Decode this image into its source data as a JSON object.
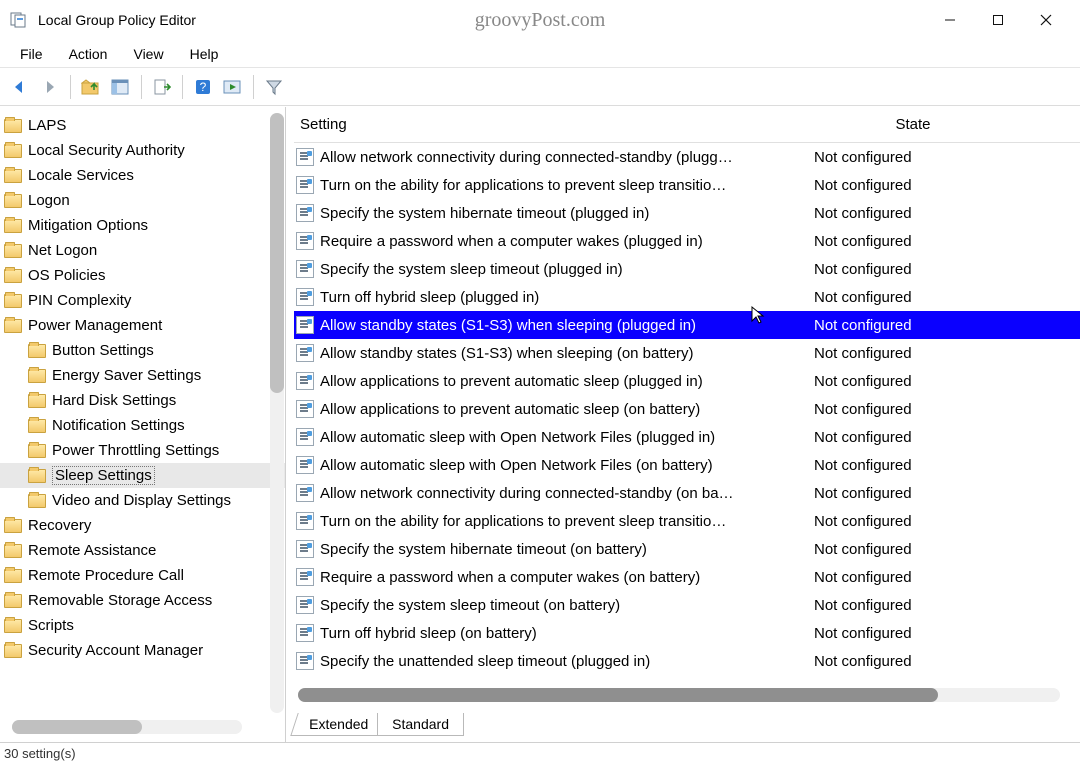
{
  "window": {
    "title": "Local Group Policy Editor",
    "watermark": "groovyPost.com"
  },
  "menu": [
    "File",
    "Action",
    "View",
    "Help"
  ],
  "toolbar_icons": [
    "back",
    "forward",
    "sep",
    "up",
    "show-hide",
    "sep",
    "export",
    "sep",
    "help",
    "play",
    "sep",
    "filter"
  ],
  "tree": [
    {
      "label": "LAPS",
      "level": 0
    },
    {
      "label": "Local Security Authority",
      "level": 0
    },
    {
      "label": "Locale Services",
      "level": 0
    },
    {
      "label": "Logon",
      "level": 0
    },
    {
      "label": "Mitigation Options",
      "level": 0
    },
    {
      "label": "Net Logon",
      "level": 0
    },
    {
      "label": "OS Policies",
      "level": 0
    },
    {
      "label": "PIN Complexity",
      "level": 0
    },
    {
      "label": "Power Management",
      "level": 0
    },
    {
      "label": "Button Settings",
      "level": 1
    },
    {
      "label": "Energy Saver Settings",
      "level": 1
    },
    {
      "label": "Hard Disk Settings",
      "level": 1
    },
    {
      "label": "Notification Settings",
      "level": 1
    },
    {
      "label": "Power Throttling Settings",
      "level": 1
    },
    {
      "label": "Sleep Settings",
      "level": 1,
      "selected": true
    },
    {
      "label": "Video and Display Settings",
      "level": 1
    },
    {
      "label": "Recovery",
      "level": 0
    },
    {
      "label": "Remote Assistance",
      "level": 0
    },
    {
      "label": "Remote Procedure Call",
      "level": 0
    },
    {
      "label": "Removable Storage Access",
      "level": 0
    },
    {
      "label": "Scripts",
      "level": 0
    },
    {
      "label": "Security Account Manager",
      "level": 0
    }
  ],
  "columns": {
    "setting": "Setting",
    "state": "State"
  },
  "rows": [
    {
      "setting": "Allow network connectivity during connected-standby (plugg…",
      "state": "Not configured"
    },
    {
      "setting": "Turn on the ability for applications to prevent sleep transitio…",
      "state": "Not configured"
    },
    {
      "setting": "Specify the system hibernate timeout (plugged in)",
      "state": "Not configured"
    },
    {
      "setting": "Require a password when a computer wakes (plugged in)",
      "state": "Not configured"
    },
    {
      "setting": "Specify the system sleep timeout (plugged in)",
      "state": "Not configured"
    },
    {
      "setting": "Turn off hybrid sleep (plugged in)",
      "state": "Not configured"
    },
    {
      "setting": "Allow standby states (S1-S3) when sleeping (plugged in)",
      "state": "Not configured",
      "selected": true
    },
    {
      "setting": "Allow standby states (S1-S3) when sleeping (on battery)",
      "state": "Not configured"
    },
    {
      "setting": "Allow applications to prevent automatic sleep (plugged in)",
      "state": "Not configured"
    },
    {
      "setting": "Allow applications to prevent automatic sleep (on battery)",
      "state": "Not configured"
    },
    {
      "setting": "Allow automatic sleep with Open Network Files (plugged in)",
      "state": "Not configured"
    },
    {
      "setting": "Allow automatic sleep with Open Network Files (on battery)",
      "state": "Not configured"
    },
    {
      "setting": "Allow network connectivity during connected-standby (on ba…",
      "state": "Not configured"
    },
    {
      "setting": "Turn on the ability for applications to prevent sleep transitio…",
      "state": "Not configured"
    },
    {
      "setting": "Specify the system hibernate timeout (on battery)",
      "state": "Not configured"
    },
    {
      "setting": "Require a password when a computer wakes (on battery)",
      "state": "Not configured"
    },
    {
      "setting": "Specify the system sleep timeout (on battery)",
      "state": "Not configured"
    },
    {
      "setting": "Turn off hybrid sleep (on battery)",
      "state": "Not configured"
    },
    {
      "setting": "Specify the unattended sleep timeout (plugged in)",
      "state": "Not configured"
    }
  ],
  "tabs": {
    "extended": "Extended",
    "standard": "Standard"
  },
  "status": "30 setting(s)"
}
